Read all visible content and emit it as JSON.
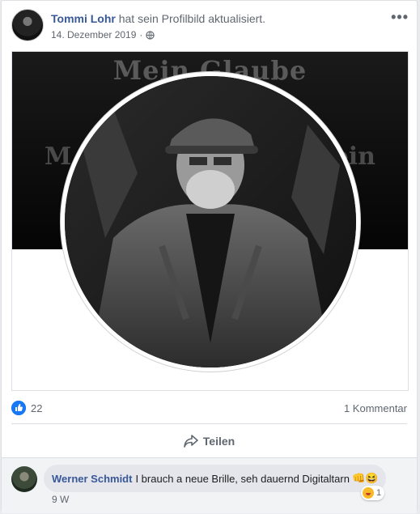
{
  "post": {
    "author": "Tommi Lohr",
    "action": "hat sein Profilbild aktualisiert.",
    "date": "14. Dezember 2019",
    "separator": "·",
    "cover_title": "Mein Glaube",
    "cover_left": "M",
    "cover_right": "ein",
    "more_label": "•••"
  },
  "stats": {
    "likes": "22",
    "comments": "1 Kommentar"
  },
  "actions": {
    "share_label": "Teilen"
  },
  "comment": {
    "author": "Werner Schmidt",
    "text": "I brauch a neue Brille, seh dauernd Digitaltarn",
    "emoji": "👊😆",
    "time": "9 W",
    "reaction_count": "1"
  },
  "colors": {
    "link": "#385898",
    "like_blue": "#1877f2",
    "muted": "#606770"
  }
}
